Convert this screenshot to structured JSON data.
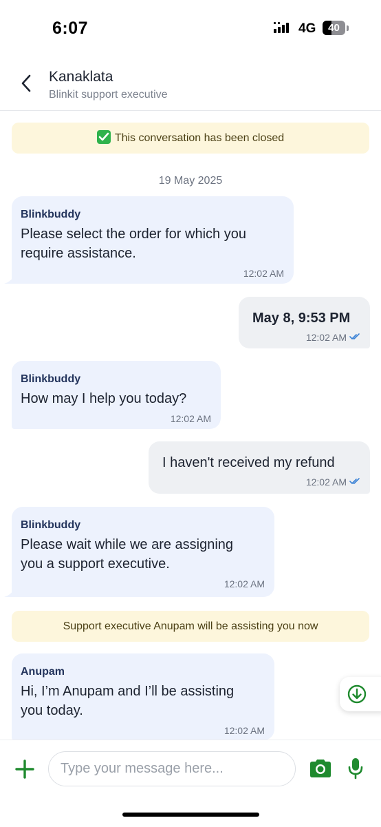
{
  "status_bar": {
    "time": "6:07",
    "network": "4G",
    "battery_level": 40,
    "battery_text": "40"
  },
  "header": {
    "name": "Kanaklata",
    "role": "Blinkit support executive"
  },
  "banners": {
    "closed": "This conversation has been closed",
    "assigned": "Support executive Anupam will be assisting you now"
  },
  "date_separator": "19 May 2025",
  "messages": [
    {
      "direction": "in",
      "sender": "Blinkbuddy",
      "text": "Please select the order for which you\nrequire assistance.",
      "time": "12:02 AM"
    },
    {
      "direction": "out",
      "text": "May 8, 9:53 PM",
      "time": "12:02 AM"
    },
    {
      "direction": "in",
      "sender": "Blinkbuddy",
      "text": "How may I help you today?",
      "time": "12:02 AM"
    },
    {
      "direction": "out",
      "text": "I haven't received my refund",
      "time": "12:02 AM"
    },
    {
      "direction": "in",
      "sender": "Blinkbuddy",
      "text": "Please wait while we are assigning\nyou a support executive.",
      "time": "12:02 AM"
    },
    {
      "direction": "in",
      "sender": "Anupam",
      "text": "Hi, I’m Anupam and I’ll be assisting\nyou today.",
      "time": "12:02 AM"
    }
  ],
  "composer": {
    "placeholder": "Type your message here..."
  },
  "colors": {
    "brand_green": "#1f8a2e",
    "incoming_bubble": "#edf2fd",
    "outgoing_bubble": "#eef0f3",
    "banner": "#fdf6dc",
    "read_tick": "#3b82d6"
  },
  "icons": [
    "back-chevron-icon",
    "check-icon",
    "double-tick-icon",
    "arrow-down-circle-icon",
    "plus-icon",
    "camera-icon",
    "microphone-icon"
  ]
}
